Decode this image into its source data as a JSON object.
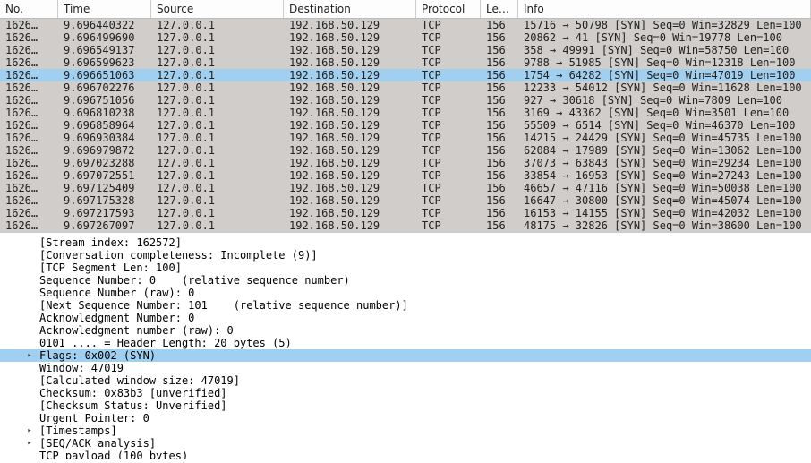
{
  "columns": {
    "no": "No.",
    "time": "Time",
    "source": "Source",
    "destination": "Destination",
    "protocol": "Protocol",
    "length": "Length",
    "info": "Info"
  },
  "packets": [
    {
      "no": "1626…",
      "time": "9.696440322",
      "source": "127.0.0.1",
      "destination": "192.168.50.129",
      "protocol": "TCP",
      "length": "156",
      "info": "15716 → 50798 [SYN] Seq=0 Win=32829 Len=100",
      "selected": false
    },
    {
      "no": "1626…",
      "time": "9.696499690",
      "source": "127.0.0.1",
      "destination": "192.168.50.129",
      "protocol": "TCP",
      "length": "156",
      "info": "20862 → 41 [SYN] Seq=0 Win=19778 Len=100",
      "selected": false
    },
    {
      "no": "1626…",
      "time": "9.696549137",
      "source": "127.0.0.1",
      "destination": "192.168.50.129",
      "protocol": "TCP",
      "length": "156",
      "info": "358 → 49991 [SYN] Seq=0 Win=58750 Len=100",
      "selected": false
    },
    {
      "no": "1626…",
      "time": "9.696599623",
      "source": "127.0.0.1",
      "destination": "192.168.50.129",
      "protocol": "TCP",
      "length": "156",
      "info": "9788 → 51985 [SYN] Seq=0 Win=12318 Len=100",
      "selected": false
    },
    {
      "no": "1626…",
      "time": "9.696651063",
      "source": "127.0.0.1",
      "destination": "192.168.50.129",
      "protocol": "TCP",
      "length": "156",
      "info": "1754 → 64282 [SYN] Seq=0 Win=47019 Len=100",
      "selected": true
    },
    {
      "no": "1626…",
      "time": "9.696702276",
      "source": "127.0.0.1",
      "destination": "192.168.50.129",
      "protocol": "TCP",
      "length": "156",
      "info": "12233 → 54012 [SYN] Seq=0 Win=11628 Len=100",
      "selected": false
    },
    {
      "no": "1626…",
      "time": "9.696751056",
      "source": "127.0.0.1",
      "destination": "192.168.50.129",
      "protocol": "TCP",
      "length": "156",
      "info": "927 → 30618 [SYN] Seq=0 Win=7809 Len=100",
      "selected": false
    },
    {
      "no": "1626…",
      "time": "9.696810238",
      "source": "127.0.0.1",
      "destination": "192.168.50.129",
      "protocol": "TCP",
      "length": "156",
      "info": "3169 → 43362 [SYN] Seq=0 Win=3501 Len=100",
      "selected": false
    },
    {
      "no": "1626…",
      "time": "9.696858964",
      "source": "127.0.0.1",
      "destination": "192.168.50.129",
      "protocol": "TCP",
      "length": "156",
      "info": "55509 → 6514 [SYN] Seq=0 Win=46370 Len=100",
      "selected": false
    },
    {
      "no": "1626…",
      "time": "9.696930384",
      "source": "127.0.0.1",
      "destination": "192.168.50.129",
      "protocol": "TCP",
      "length": "156",
      "info": "14215 → 24429 [SYN] Seq=0 Win=45735 Len=100",
      "selected": false
    },
    {
      "no": "1626…",
      "time": "9.696979872",
      "source": "127.0.0.1",
      "destination": "192.168.50.129",
      "protocol": "TCP",
      "length": "156",
      "info": "62084 → 17989 [SYN] Seq=0 Win=13062 Len=100",
      "selected": false
    },
    {
      "no": "1626…",
      "time": "9.697023288",
      "source": "127.0.0.1",
      "destination": "192.168.50.129",
      "protocol": "TCP",
      "length": "156",
      "info": "37073 → 63843 [SYN] Seq=0 Win=29234 Len=100",
      "selected": false
    },
    {
      "no": "1626…",
      "time": "9.697072551",
      "source": "127.0.0.1",
      "destination": "192.168.50.129",
      "protocol": "TCP",
      "length": "156",
      "info": "33854 → 16953 [SYN] Seq=0 Win=27243 Len=100",
      "selected": false
    },
    {
      "no": "1626…",
      "time": "9.697125409",
      "source": "127.0.0.1",
      "destination": "192.168.50.129",
      "protocol": "TCP",
      "length": "156",
      "info": "46657 → 47116 [SYN] Seq=0 Win=50038 Len=100",
      "selected": false
    },
    {
      "no": "1626…",
      "time": "9.697175328",
      "source": "127.0.0.1",
      "destination": "192.168.50.129",
      "protocol": "TCP",
      "length": "156",
      "info": "16647 → 30800 [SYN] Seq=0 Win=45074 Len=100",
      "selected": false
    },
    {
      "no": "1626…",
      "time": "9.697217593",
      "source": "127.0.0.1",
      "destination": "192.168.50.129",
      "protocol": "TCP",
      "length": "156",
      "info": "16153 → 14155 [SYN] Seq=0 Win=42032 Len=100",
      "selected": false
    },
    {
      "no": "1626…",
      "time": "9.697267097",
      "source": "127.0.0.1",
      "destination": "192.168.50.129",
      "protocol": "TCP",
      "length": "156",
      "info": "48175 → 32826 [SYN] Seq=0 Win=38600 Len=100",
      "selected": false
    }
  ],
  "details": [
    {
      "text": "[Stream index: 162572]",
      "expander": "",
      "selected": false
    },
    {
      "text": "[Conversation completeness: Incomplete (9)]",
      "expander": "",
      "selected": false
    },
    {
      "text": "[TCP Segment Len: 100]",
      "expander": "",
      "selected": false
    },
    {
      "text": "Sequence Number: 0    (relative sequence number)",
      "expander": "",
      "selected": false
    },
    {
      "text": "Sequence Number (raw): 0",
      "expander": "",
      "selected": false
    },
    {
      "text": "[Next Sequence Number: 101    (relative sequence number)]",
      "expander": "",
      "selected": false
    },
    {
      "text": "Acknowledgment Number: 0",
      "expander": "",
      "selected": false
    },
    {
      "text": "Acknowledgment number (raw): 0",
      "expander": "",
      "selected": false
    },
    {
      "text": "0101 .... = Header Length: 20 bytes (5)",
      "expander": "",
      "selected": false
    },
    {
      "text": "Flags: 0x002 (SYN)",
      "expander": "right",
      "selected": true
    },
    {
      "text": "Window: 47019",
      "expander": "",
      "selected": false
    },
    {
      "text": "[Calculated window size: 47019]",
      "expander": "",
      "selected": false
    },
    {
      "text": "Checksum: 0x83b3 [unverified]",
      "expander": "",
      "selected": false
    },
    {
      "text": "[Checksum Status: Unverified]",
      "expander": "",
      "selected": false
    },
    {
      "text": "Urgent Pointer: 0",
      "expander": "",
      "selected": false
    },
    {
      "text": "[Timestamps]",
      "expander": "right",
      "selected": false
    },
    {
      "text": "[SEQ/ACK analysis]",
      "expander": "right",
      "selected": false
    },
    {
      "text": "TCP payload (100 bytes)",
      "expander": "",
      "selected": false
    }
  ]
}
